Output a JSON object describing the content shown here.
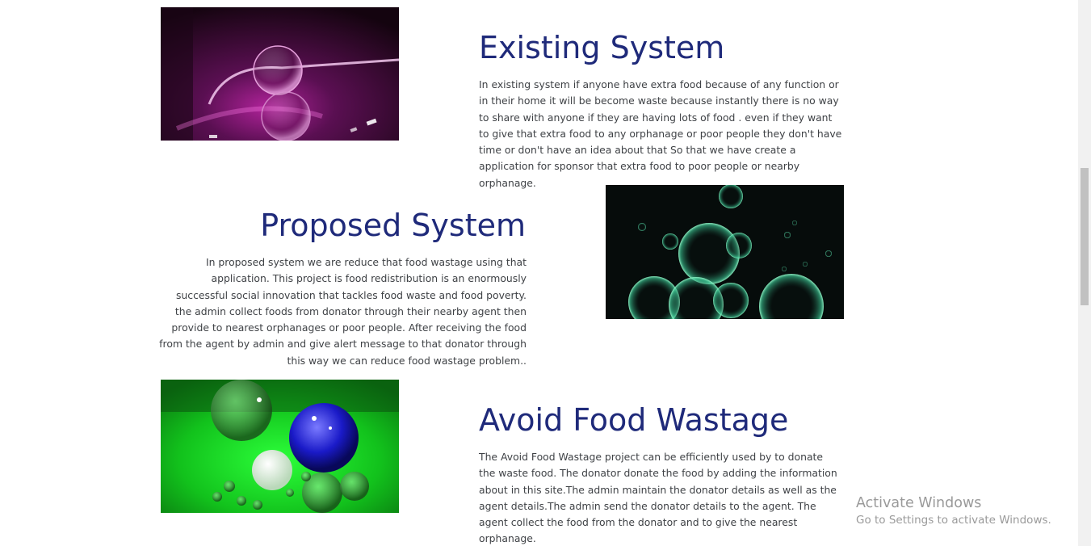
{
  "sections": [
    {
      "heading": "Existing System",
      "image_name": "purple-glass-sphere-image",
      "text": "In existing system if anyone have extra food because of any function or in their home it will be become waste because instantly there is no way to share with anyone if they are having lots of food . even if they want to give that extra food to any orphanage or poor people they don't have time or don't have an idea about that So that we have create a application for sponsor that extra food to poor people or nearby orphanage."
    },
    {
      "heading": "Proposed System",
      "image_name": "green-bubbles-image",
      "text": "In proposed system we are reduce that food wastage using that application. This project is food redistribution is an enormously successful social innovation that tackles food waste and food poverty. the admin collect foods from donator through their nearby agent then provide to nearest orphanages or poor people. After receiving the food from the agent by admin and give alert message to that donator through this way we can reduce food wastage problem.."
    },
    {
      "heading": "Avoid Food Wastage",
      "image_name": "green-glass-balls-image",
      "text": "The Avoid Food Wastage project can be efficiently used by to donate the waste food. The donator donate the food by adding the information about in this site.The admin maintain the donator details as well as the agent details.The admin send the donator details to the agent. The agent collect the food from the donator and to give the nearest orphanage."
    }
  ],
  "watermark": {
    "title": "Activate Windows",
    "subtitle": "Go to Settings to activate Windows."
  },
  "colors": {
    "heading": "#1f2a7a",
    "body_text": "#3f4246",
    "watermark": "#9a9a9a"
  }
}
